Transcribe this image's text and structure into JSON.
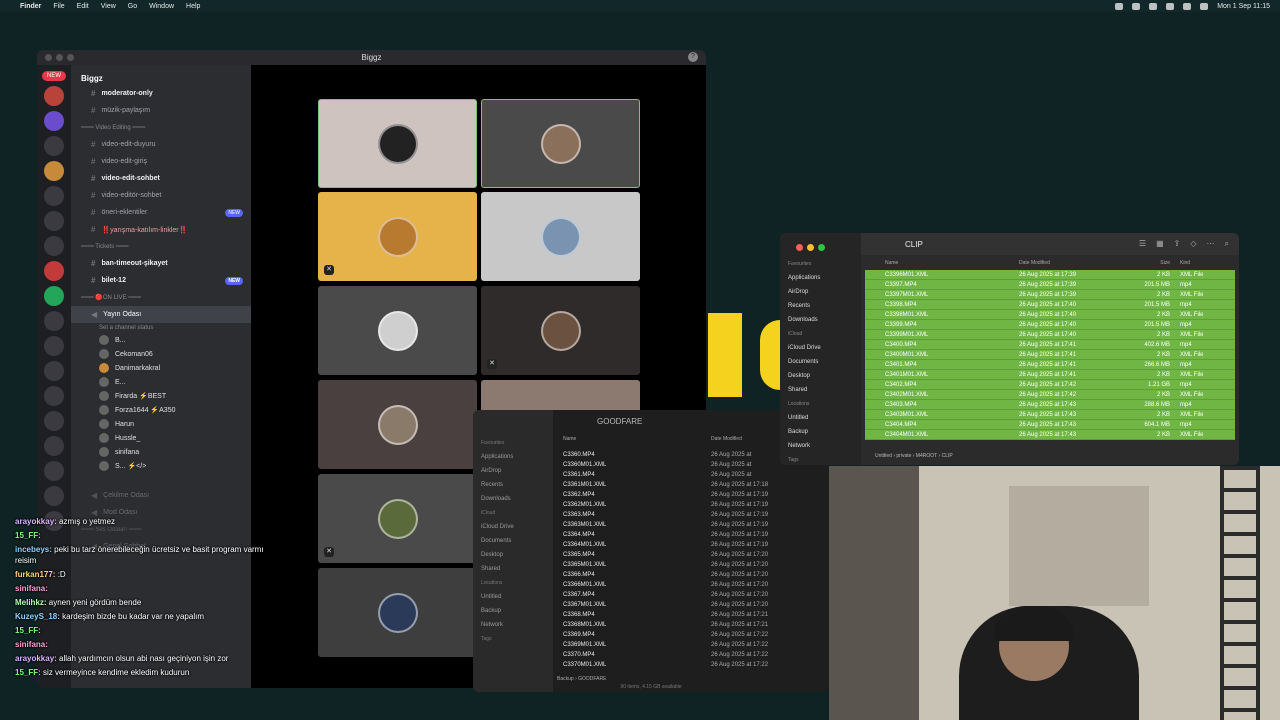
{
  "menubar": {
    "app": "Finder",
    "items": [
      "File",
      "Edit",
      "View",
      "Go",
      "Window",
      "Help"
    ],
    "clock": "Mon 1 Sep 11:15"
  },
  "discord": {
    "window_title": "Biggz",
    "server_badge": "NEW",
    "guild": "Biggz",
    "channels": [
      {
        "label": "moderator-only",
        "bold": true,
        "hash": false
      },
      {
        "label": "müzik-paylaşım"
      },
      {
        "cat": "═══ Video Editing ═══"
      },
      {
        "label": "video-edit-duyuru"
      },
      {
        "label": "video-edit-giriş"
      },
      {
        "label": "video-edit-sohbet",
        "bold": true
      },
      {
        "label": "video-editör-sohbet"
      },
      {
        "label": "öneri-eklentiler",
        "tag": "NEW"
      },
      {
        "label": "‼️yarışma-katılım-linkler‼️"
      },
      {
        "cat": "═══ Tickets ═══"
      },
      {
        "label": "ban-timeout-şikayet",
        "bold": true
      },
      {
        "label": "bilet-12",
        "bold": true,
        "tag": "NEW"
      },
      {
        "cat": "═══ 🔴ON LIVE ═══"
      }
    ],
    "voice_channel": {
      "label": "Yayın Odası",
      "status": "Set a channel status"
    },
    "voice_users": [
      "B...",
      "Cekoman06",
      "Danimarkakral",
      "E...",
      "Firarda ⚡BEST",
      "Forza1644 ⚡A350",
      "Harun",
      "Hussle_",
      "sinifana",
      "S... ⚡</>"
    ],
    "lower_channels": [
      "Çekilme Odası",
      "Mod Odası",
      "═══ Ses Odaları ═══",
      "Genel Sohbet"
    ]
  },
  "finder_goodfare": {
    "title": "GOODFARE",
    "sidebar": {
      "favourites_header": "Favourites",
      "favourites": [
        "Applications",
        "AirDrop",
        "Recents",
        "Downloads"
      ],
      "icloud_header": "iCloud",
      "icloud": [
        "iCloud Drive",
        "Documents",
        "Desktop",
        "Shared"
      ],
      "locations_header": "Locations",
      "locations": [
        "Untitled",
        "Backup",
        "Network"
      ],
      "tags_header": "Tags"
    },
    "col_name": "Name",
    "col_date": "Date Modified",
    "files": [
      {
        "n": "C3360.MP4",
        "d": "26 Aug 2025 at"
      },
      {
        "n": "C3360M01.XML",
        "d": "26 Aug 2025 at"
      },
      {
        "n": "C3361.MP4",
        "d": "26 Aug 2025 at"
      },
      {
        "n": "C3361M01.XML",
        "d": "26 Aug 2025 at 17:18"
      },
      {
        "n": "C3362.MP4",
        "d": "26 Aug 2025 at 17:19"
      },
      {
        "n": "C3362M01.XML",
        "d": "26 Aug 2025 at 17:19"
      },
      {
        "n": "C3363.MP4",
        "d": "26 Aug 2025 at 17:19"
      },
      {
        "n": "C3363M01.XML",
        "d": "26 Aug 2025 at 17:19"
      },
      {
        "n": "C3364.MP4",
        "d": "26 Aug 2025 at 17:19"
      },
      {
        "n": "C3364M01.XML",
        "d": "26 Aug 2025 at 17:19"
      },
      {
        "n": "C3365.MP4",
        "d": "26 Aug 2025 at 17:20"
      },
      {
        "n": "C3365M01.XML",
        "d": "26 Aug 2025 at 17:20"
      },
      {
        "n": "C3366.MP4",
        "d": "26 Aug 2025 at 17:20"
      },
      {
        "n": "C3366M01.XML",
        "d": "26 Aug 2025 at 17:20"
      },
      {
        "n": "C3367.MP4",
        "d": "26 Aug 2025 at 17:20"
      },
      {
        "n": "C3367M01.XML",
        "d": "26 Aug 2025 at 17:20"
      },
      {
        "n": "C3368.MP4",
        "d": "26 Aug 2025 at 17:21"
      },
      {
        "n": "C3368M01.XML",
        "d": "26 Aug 2025 at 17:21"
      },
      {
        "n": "C3369.MP4",
        "d": "26 Aug 2025 at 17:22"
      },
      {
        "n": "C3369M01.XML",
        "d": "26 Aug 2025 at 17:22"
      },
      {
        "n": "C3370.MP4",
        "d": "26 Aug 2025 at 17:22"
      },
      {
        "n": "C3370M01.XML",
        "d": "26 Aug 2025 at 17:22"
      }
    ],
    "path": "Backup › GOODFARE",
    "footer": "90 items, 4.15 GB available"
  },
  "finder_clip": {
    "title": "CLIP",
    "sidebar": {
      "favourites_header": "Favourites",
      "favourites": [
        "Applications",
        "AirDrop",
        "Recents",
        "Downloads"
      ],
      "icloud_header": "iCloud",
      "icloud": [
        "iCloud Drive",
        "Documents",
        "Desktop",
        "Shared"
      ],
      "locations_header": "Locations",
      "locations": [
        "Untitled",
        "Backup",
        "Network"
      ],
      "tags_header": "Tags"
    },
    "col_name": "Name",
    "col_date": "Date Modified",
    "col_size": "Size",
    "col_kind": "Kind",
    "files": [
      {
        "n": "C3396M01.XML",
        "d": "26 Aug 2025 at 17:39",
        "s": "2 KB",
        "k": "XML File"
      },
      {
        "n": "C3397.MP4",
        "d": "26 Aug 2025 at 17:39",
        "s": "201.5 MB",
        "k": "mp4"
      },
      {
        "n": "C3397M01.XML",
        "d": "26 Aug 2025 at 17:39",
        "s": "2 KB",
        "k": "XML File"
      },
      {
        "n": "C3398.MP4",
        "d": "26 Aug 2025 at 17:40",
        "s": "201.5 MB",
        "k": "mp4"
      },
      {
        "n": "C3398M01.XML",
        "d": "26 Aug 2025 at 17:40",
        "s": "2 KB",
        "k": "XML File"
      },
      {
        "n": "C3399.MP4",
        "d": "26 Aug 2025 at 17:40",
        "s": "201.5 MB",
        "k": "mp4"
      },
      {
        "n": "C3399M01.XML",
        "d": "26 Aug 2025 at 17:40",
        "s": "2 KB",
        "k": "XML File"
      },
      {
        "n": "C3400.MP4",
        "d": "26 Aug 2025 at 17:41",
        "s": "402.6 MB",
        "k": "mp4"
      },
      {
        "n": "C3400M01.XML",
        "d": "26 Aug 2025 at 17:41",
        "s": "2 KB",
        "k": "XML File"
      },
      {
        "n": "C3401.MP4",
        "d": "26 Aug 2025 at 17:41",
        "s": "266.6 MB",
        "k": "mp4"
      },
      {
        "n": "C3401M01.XML",
        "d": "26 Aug 2025 at 17:41",
        "s": "2 KB",
        "k": "XML File"
      },
      {
        "n": "C3402.MP4",
        "d": "26 Aug 2025 at 17:42",
        "s": "1.21 GB",
        "k": "mp4"
      },
      {
        "n": "C3402M01.XML",
        "d": "26 Aug 2025 at 17:42",
        "s": "2 KB",
        "k": "XML File"
      },
      {
        "n": "C3403.MP4",
        "d": "26 Aug 2025 at 17:43",
        "s": "288.6 MB",
        "k": "mp4"
      },
      {
        "n": "C3403M01.XML",
        "d": "26 Aug 2025 at 17:43",
        "s": "2 KB",
        "k": "XML File"
      },
      {
        "n": "C3404.MP4",
        "d": "26 Aug 2025 at 17:43",
        "s": "604.1 MB",
        "k": "mp4"
      },
      {
        "n": "C3404M01.XML",
        "d": "26 Aug 2025 at 17:43",
        "s": "2 KB",
        "k": "XML File"
      }
    ],
    "path": "Untitled › private › M4ROOT › CLIP"
  },
  "chat": [
    {
      "u": "arayokkay",
      "c": "#d9b3ff",
      "t": "azmış o yetmez"
    },
    {
      "u": "15_FF",
      "c": "#7dff7d",
      "t": ""
    },
    {
      "u": "incebeys",
      "c": "#8fd3ff",
      "t": "peki bu tarz önerebileceğin ücretsiz ve basit program varmı reisim"
    },
    {
      "u": "furkan177",
      "c": "#ffd27d",
      "t": ":D"
    },
    {
      "u": "sinifana",
      "c": "#ff9ed2",
      "t": ""
    },
    {
      "u": "Melihkz",
      "c": "#b3ffb3",
      "t": "aynen yeni gördüm bende"
    },
    {
      "u": "KuzeyS_18",
      "c": "#8fd3ff",
      "t": "kardeşim bizde bu kadar var ne yapalım"
    },
    {
      "u": "15_FF",
      "c": "#7dff7d",
      "t": ""
    },
    {
      "u": "sinifana",
      "c": "#ff9ed2",
      "t": ""
    },
    {
      "u": "arayokkay",
      "c": "#d9b3ff",
      "t": "allah yardımcın olsun abi nası geçiniyon işin zor"
    },
    {
      "u": "15_FF",
      "c": "#7dff7d",
      "t": "siz vermeyince kendime ekledim kudurun"
    }
  ],
  "colors": {
    "selection_green": "#6fb644",
    "desktop": "#0f2224",
    "accent_yellow": "#f5d21e"
  }
}
